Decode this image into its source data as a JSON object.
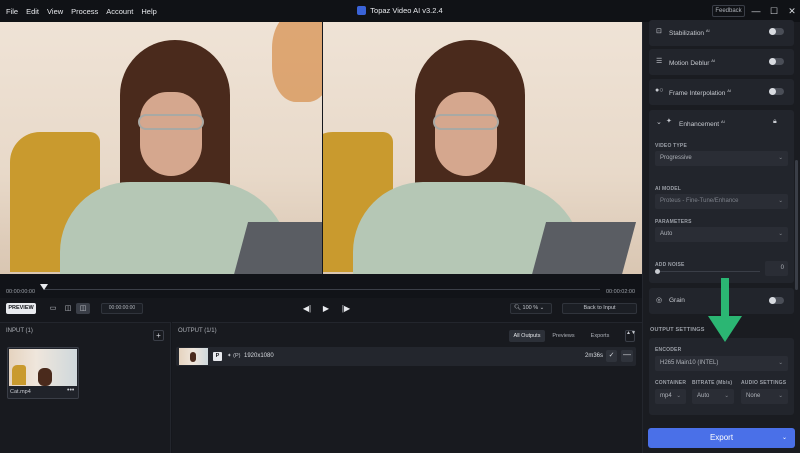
{
  "menu": [
    "File",
    "Edit",
    "View",
    "Process",
    "Account",
    "Help"
  ],
  "app": {
    "title": "Topaz Video AI  v3.2.4",
    "feedback": "Feedback"
  },
  "window_controls": {
    "minimize": "—",
    "maximize": "☐",
    "close": "✕"
  },
  "timeline": {
    "start": "00:00:00:00",
    "end": "00:00:02:00"
  },
  "controls": {
    "preview": "PREVIEW",
    "timecode": "00:00:00:00",
    "prev_frame": "◀|",
    "play": "▶",
    "next_frame": "|▶",
    "zoom": "100 %",
    "back_to_input": "Back to Input"
  },
  "input": {
    "title": "INPUT (1)",
    "add": "+",
    "file": {
      "name": "Cat.mp4",
      "more": "•••"
    }
  },
  "output": {
    "title": "OUTPUT (1/1)",
    "tabs": [
      "All Outputs",
      "Previews",
      "Exports"
    ],
    "sort": "▲▼",
    "row": {
      "badge": "P",
      "model": "(P)",
      "resolution": "1920x1080",
      "duration": "2m36s",
      "check": "✓",
      "remove": "—"
    }
  },
  "right_panel": {
    "stabilization": {
      "label": "Stabilization",
      "sup": "AI",
      "enabled": false
    },
    "motion_deblur": {
      "label": "Motion Deblur",
      "sup": "AI",
      "enabled": false
    },
    "frame_interpolation": {
      "label": "Frame Interpolation",
      "sup": "AI",
      "enabled": false
    },
    "enhancement": {
      "label": "Enhancement",
      "sup": "AI",
      "video_type_label": "VIDEO TYPE",
      "video_type": "Progressive",
      "ai_model_label": "AI MODEL",
      "ai_model": "Proteus - Fine-Tune/Enhance",
      "parameters_label": "PARAMETERS",
      "parameters": "Auto",
      "add_noise_label": "ADD NOISE",
      "add_noise_value": "0"
    },
    "grain": {
      "label": "Grain",
      "enabled": false
    },
    "output_settings": {
      "title": "OUTPUT SETTINGS",
      "encoder_label": "ENCODER",
      "encoder": "H265 Main10 (INTEL)",
      "container_label": "CONTAINER",
      "container": "mp4",
      "bitrate_label": "BITRATE (Mb/s)",
      "bitrate": "Auto",
      "audio_label": "AUDIO SETTINGS",
      "audio": "None"
    },
    "export": "Export"
  },
  "colors": {
    "accent": "#4a70e8",
    "arrow": "#2bb673"
  }
}
